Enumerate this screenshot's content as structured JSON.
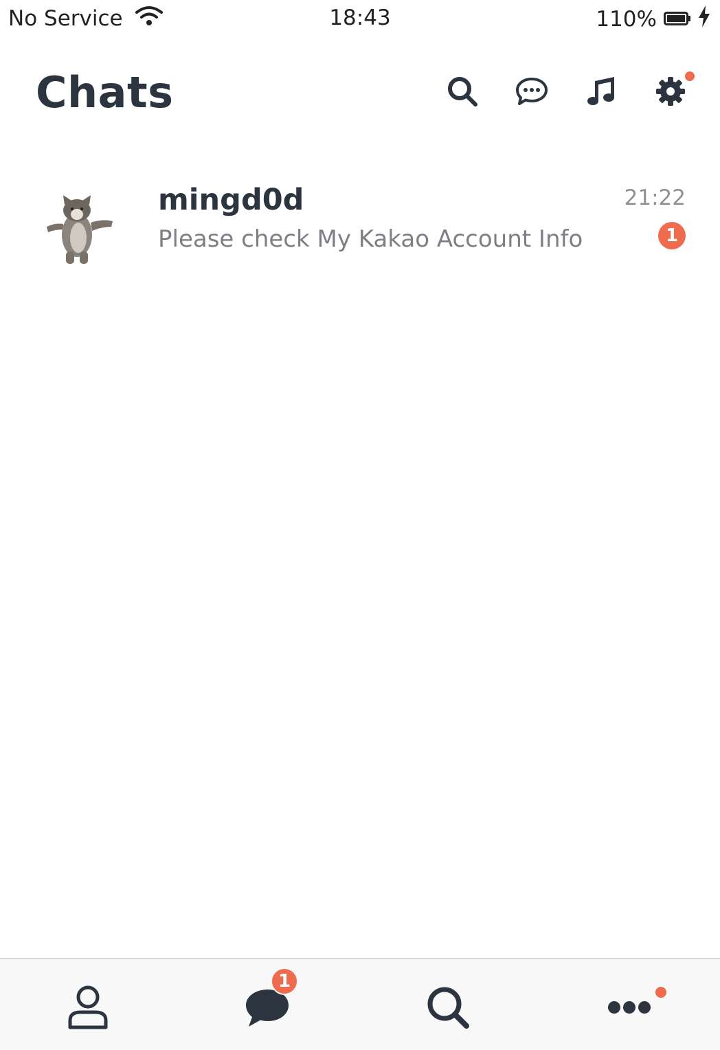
{
  "status_bar": {
    "carrier": "No Service",
    "time": "18:43",
    "battery": "110%"
  },
  "header": {
    "title": "Chats",
    "icons": [
      "search-icon",
      "new-chat-icon",
      "music-icon",
      "settings-icon"
    ],
    "settings_has_notification": true
  },
  "chats": [
    {
      "name": "mingd0d",
      "preview": "Please check My Kakao Account Info",
      "time": "21:22",
      "unread": "1",
      "avatar": "cat-avatar"
    }
  ],
  "tab_bar": {
    "tabs": [
      "friends-tab",
      "chats-tab",
      "search-tab",
      "more-tab"
    ],
    "chats_badge": "1",
    "more_has_notification": true
  },
  "colors": {
    "accent": "#ee6b4d",
    "icon": "#2c3440",
    "text_secondary": "#7d7f84"
  }
}
